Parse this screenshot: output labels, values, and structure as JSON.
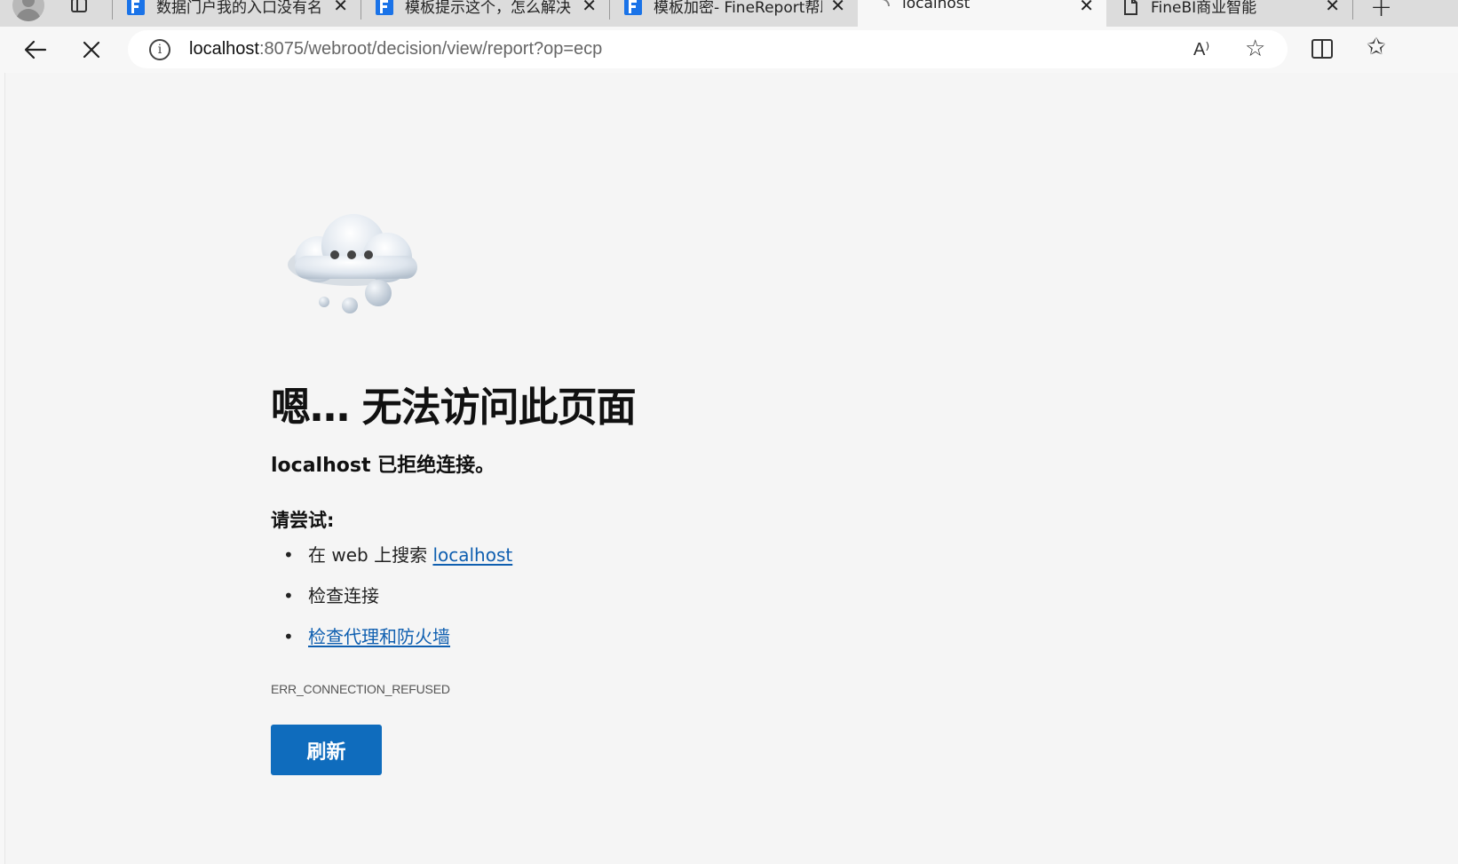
{
  "browser": {
    "tabs": [
      {
        "title": "数据门户我的入口没有名",
        "favicon": "finereport-logo-icon",
        "active": false
      },
      {
        "title": "模板提示这个，怎么解决",
        "favicon": "finereport-logo-icon",
        "active": false
      },
      {
        "title": "模板加密- FineReport帮助",
        "favicon": "finereport-logo-icon",
        "active": false
      },
      {
        "title": "localhost",
        "favicon": "loading-spinner-icon",
        "active": true
      },
      {
        "title": "FineBI商业智能",
        "favicon": "page-icon",
        "active": false
      }
    ],
    "close_glyph": "✕",
    "new_tab_glyph": "+",
    "address": {
      "host": "localhost",
      "path": ":8075/webroot/decision/view/report?op=ecp"
    },
    "read_aloud_glyph": "A⁾",
    "favorite_glyph": "☆",
    "favorites_glyph": "✩"
  },
  "error_page": {
    "illustration": "cloud-icon",
    "heading": "嗯… 无法访问此页面",
    "subheading": "localhost 已拒绝连接。",
    "try_label": "请尝试:",
    "suggestions": [
      {
        "prefix": "在 web 上搜索 ",
        "link": "localhost"
      },
      {
        "text": "检查连接"
      },
      {
        "link": "检查代理和防火墙"
      }
    ],
    "error_code": "ERR_CONNECTION_REFUSED",
    "refresh_label": "刷新",
    "colors": {
      "button": "#0f6cbd",
      "link": "#0f5fb0",
      "background": "#f5f5f5"
    }
  }
}
